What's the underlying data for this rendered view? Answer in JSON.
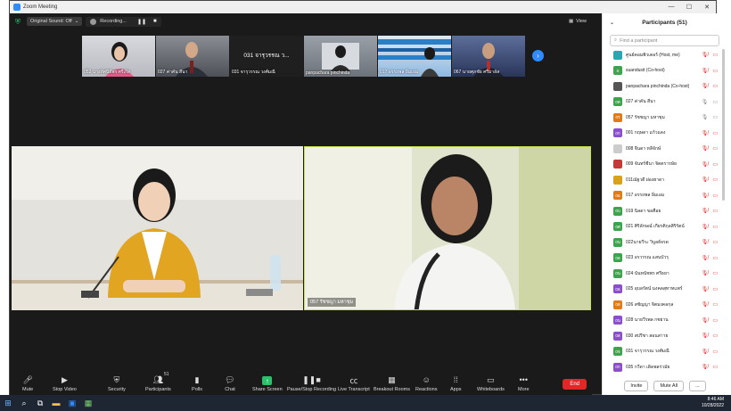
{
  "window": {
    "title": "Zoom Meeting"
  },
  "topbar": {
    "original_sound": "Original Sound: Off",
    "recording": "Recording...",
    "view": "View"
  },
  "thumbnails": [
    {
      "label": "052 นางทัศนีย์พร ศรีเกิด",
      "bg": "#c7c9cf"
    },
    {
      "label": "027 ค่าคัน สีนา",
      "bg": "#6a6e74"
    },
    {
      "label": "031 จารุวรรณ วงศ์มณี",
      "bg": "#1f1f1f",
      "center_text": "031 จารุวรรณ ว..."
    },
    {
      "label": "panpachara pinchinda",
      "bg": "#8a8f96"
    },
    {
      "label": "017 อรรถพล อิ่มเอม",
      "bg": "#2a7fc9"
    },
    {
      "label": "067 นายศุภชัย ศรีมาลัส",
      "bg": "#3c4f7a"
    }
  ],
  "main_tiles": [
    {
      "label": "",
      "name": "speaker-left"
    },
    {
      "label": "057 รัชชญา มหาชุม",
      "name": "speaker-right"
    }
  ],
  "toolbar": {
    "mute": "Mute",
    "stop_video": "Stop Video",
    "security": "Security",
    "participants": "Participants",
    "participants_count": "51",
    "polls": "Polls",
    "chat": "Chat",
    "share_screen": "Share Screen",
    "pause_stop_recording": "Pause/Stop Recording",
    "live_transcript": "Live Transcript",
    "breakout_rooms": "Breakout Rooms",
    "reactions": "Reactions",
    "apps": "Apps",
    "whiteboards": "Whiteboards",
    "more": "More",
    "end": "End"
  },
  "panel": {
    "title": "Participants (51)",
    "search_placeholder": "Find a participant",
    "invite": "Invite",
    "mute_all": "Mute All",
    "more": "...",
    "participants": [
      {
        "avatar": "",
        "avatar_color": "#2aa6b3",
        "name": "ศูนย์คอมพิวเตอร์ (Host, me)",
        "mic": "off",
        "video": "off"
      },
      {
        "avatar": "S",
        "avatar_color": "#3fa34d",
        "name": "suandusit (Co-host)",
        "mic": "off",
        "video": "off"
      },
      {
        "avatar": "",
        "avatar_color": "#555555",
        "name": "panpachara pinchinda (Co-host)",
        "mic": "off",
        "video": "off"
      },
      {
        "avatar": "0ค",
        "avatar_color": "#3fa34d",
        "name": "027 ค่าคัน สีนา",
        "mic": "on",
        "video": "on"
      },
      {
        "avatar": "0ร",
        "avatar_color": "#e07b1a",
        "name": "057 รัชชญา มหาชุม",
        "mic": "on",
        "video": "on"
      },
      {
        "avatar": "0ก",
        "avatar_color": "#8a4fc9",
        "name": "001 กฤษดา แก้วแดง",
        "mic": "off",
        "video": "off"
      },
      {
        "avatar": "",
        "avatar_color": "#cccccc",
        "name": "008 จีนดา หลีจักษ์",
        "mic": "off",
        "video": "off"
      },
      {
        "avatar": "",
        "avatar_color": "#c23a3a",
        "name": "009 จันทร์ชีนา จิตตรารษัย",
        "mic": "off",
        "video": "off"
      },
      {
        "avatar": "",
        "avatar_color": "#d9a21b",
        "name": "011ณัฐวดี ผ่องฮาดา",
        "mic": "off",
        "video": "off"
      },
      {
        "avatar": "0อ",
        "avatar_color": "#e07b1a",
        "name": "017 อรรถพล อิ่มเอม",
        "mic": "off",
        "video": "off"
      },
      {
        "avatar": "0บ",
        "avatar_color": "#3fa34d",
        "name": "019 นิลดา ขอคือย",
        "mic": "off",
        "video": "off"
      },
      {
        "avatar": "0ศ",
        "avatar_color": "#3fa34d",
        "name": "021 ศิริลักษณ์ เกียรติกุลสิริรัตน์",
        "mic": "off",
        "video": "off"
      },
      {
        "avatar": "0น",
        "avatar_color": "#3fa34d",
        "name": "022นายวีระ วิบูลย์จรด",
        "mic": "off",
        "video": "off"
      },
      {
        "avatar": "0อ",
        "avatar_color": "#3fa34d",
        "name": "023 อรวรรณ แสนบัวรุ",
        "mic": "off",
        "video": "off"
      },
      {
        "avatar": "0น",
        "avatar_color": "#3fa34d",
        "name": "024 นันทนัชพร ศรีธยา",
        "mic": "off",
        "video": "off"
      },
      {
        "avatar": "0อ",
        "avatar_color": "#8a4fc9",
        "name": "025 อุบลรัตน์ มงคลสุทาทแพร์",
        "mic": "off",
        "video": "off"
      },
      {
        "avatar": "0ส",
        "avatar_color": "#e07b1a",
        "name": "026 สชัญญา จิตมงคลกุล",
        "mic": "off",
        "video": "off"
      },
      {
        "avatar": "0น",
        "avatar_color": "#8a4fc9",
        "name": "028 นายวีรพล กชยาน",
        "mic": "off",
        "video": "off"
      },
      {
        "avatar": "0ส",
        "avatar_color": "#8a4fc9",
        "name": "030 สปรีชา สอนสาาย",
        "mic": "off",
        "video": "off"
      },
      {
        "avatar": "0จ",
        "avatar_color": "#3fa34d",
        "name": "031 จารุวรรณ วงศ์มณี",
        "mic": "off",
        "video": "off"
      },
      {
        "avatar": "0ก",
        "avatar_color": "#8a4fc9",
        "name": "035 กวีดา เดิดพลร่วมัย",
        "mic": "off",
        "video": "off"
      }
    ]
  },
  "taskbar": {
    "time": "8:46 AM",
    "date": "10/28/2022"
  }
}
